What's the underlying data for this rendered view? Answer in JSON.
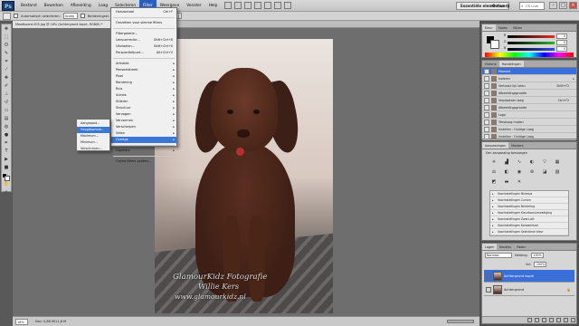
{
  "menubar": {
    "logo": "Ps",
    "items": [
      "Bestand",
      "Bewerken",
      "Afbeelding",
      "Laag",
      "Selecteren",
      "Filter",
      "Weergave",
      "Venster",
      "Help"
    ],
    "active_index": 5,
    "workspace_primary": "Essentiële elementen",
    "workspace_secondary": "Ontwerp",
    "search_label": "CS Live"
  },
  "options": {
    "auto_select_label": "Automatisch selecteren:",
    "auto_select_value": "Groep",
    "transform_label": "Bedieningsel. tonen"
  },
  "document": {
    "tab_title": "Moodboard-003.jpg @ 18% (Achtergrond kopie, RGB/8) *"
  },
  "photo": {
    "watermark_line1": "GlamourKidz Fotografie",
    "watermark_line2": "Willie Kers",
    "watermark_line3": "www.glamourkidz.nl"
  },
  "statusbar": {
    "zoom": "18%",
    "doc_info": "Doc: 5,88 M/11,8 M"
  },
  "filter_menu": {
    "items": [
      {
        "label": "Horizontaal",
        "shortcut": "Ctrl+F",
        "disabled": false
      },
      {
        "sep": true
      },
      {
        "label": "Omzetten voor slimme filters",
        "disabled": false
      },
      {
        "sep": true
      },
      {
        "label": "Filtergalerie...",
        "disabled": false
      },
      {
        "label": "Lenscorrectie...",
        "shortcut": "Shift+Ctrl+R",
        "disabled": false
      },
      {
        "label": "Uitvloeien...",
        "shortcut": "Shift+Ctrl+X",
        "disabled": false
      },
      {
        "label": "Perspectiefpunt...",
        "shortcut": "Alt+Ctrl+V",
        "disabled": false
      },
      {
        "sep": true
      },
      {
        "label": "Artistiek",
        "submenu": true
      },
      {
        "label": "Penseelstreek",
        "submenu": true
      },
      {
        "label": "Pixel",
        "submenu": true
      },
      {
        "label": "Rendering",
        "submenu": true
      },
      {
        "label": "Ruis",
        "submenu": true
      },
      {
        "label": "Schets",
        "submenu": true
      },
      {
        "label": "Stileren",
        "submenu": true
      },
      {
        "label": "Structuur",
        "submenu": true
      },
      {
        "label": "Vervagen",
        "submenu": true
      },
      {
        "label": "Vervormen",
        "submenu": true
      },
      {
        "label": "Verscherpen",
        "submenu": true
      },
      {
        "label": "Video",
        "submenu": true
      },
      {
        "label": "Overige",
        "submenu": true,
        "highlighted": true
      },
      {
        "sep": true
      },
      {
        "label": "Digimarc",
        "submenu": true
      },
      {
        "sep": true
      },
      {
        "label": "Online filters zoeken...",
        "disabled": false
      }
    ]
  },
  "submenu": {
    "items": [
      "Aangepast...",
      "Hoogdoorlaat...",
      "Maximum...",
      "Minimum...",
      "Verschuiven..."
    ],
    "highlighted_index": 1
  },
  "color_panel": {
    "tabs": [
      "Kleur",
      "Stalen",
      "Stijlen"
    ],
    "sliders": [
      {
        "label": "R",
        "value": "0",
        "color": "#e03030"
      },
      {
        "label": "G",
        "value": "0",
        "color": "#30b030"
      },
      {
        "label": "B",
        "value": "0",
        "color": "#3050e0"
      }
    ]
  },
  "history_panel": {
    "tabs": [
      "Historie",
      "Handelingen"
    ],
    "rows": [
      {
        "label": "Moment",
        "keys": "",
        "selected": true
      },
      {
        "label": "Isoleren",
        "keys": ""
      },
      {
        "label": "Verticale lijn laten",
        "keys": "Shift+F2"
      },
      {
        "label": "Afbeeldingsgrootte",
        "keys": ""
      },
      {
        "label": "Verplaatsen laag",
        "keys": "Ctrl+F2"
      },
      {
        "label": "Afbeeldingsgrootte",
        "keys": ""
      },
      {
        "label": "Logo",
        "keys": ""
      },
      {
        "label": "Tekstlaag maken",
        "keys": ""
      },
      {
        "label": "Instellen : Huidige Laag",
        "keys": ""
      },
      {
        "label": "Instellen : Huidige Laag",
        "keys": ""
      }
    ]
  },
  "adjustments_panel": {
    "tabs": [
      "Aanpassingen",
      "Maskers"
    ],
    "title": "Een aanpassing toevoegen",
    "icons": [
      "brightness-icon",
      "levels-icon",
      "curves-icon",
      "exposure-icon",
      "vibrance-icon",
      "hue-icon",
      "balance-icon",
      "bw-icon",
      "photo-filter-icon",
      "channel-mixer-icon",
      "invert-icon",
      "posterize-icon",
      "threshold-icon",
      "gradient-map-icon",
      "selective-color-icon"
    ],
    "presets": [
      "Voorinstellingen Niveaus",
      "Voorinstellingen Curven",
      "Voorinstellingen Belichting",
      "Voorinstellingen Kleurtoon/verzadiging",
      "Voorinstellingen Zwart-wit",
      "Voorinstellingen Kanaalmixer",
      "Voorinstellingen Selectieve kleur"
    ]
  },
  "layers_panel": {
    "tabs": [
      "Lagen",
      "Kanalen",
      "Paden"
    ],
    "blend_mode": "Normaal",
    "opacity_label": "Dekking:",
    "opacity": "100%",
    "fill_label": "Vul:",
    "fill": "100%",
    "layers": [
      {
        "label": "Achtergrond kopie",
        "selected": true
      },
      {
        "label": "Achtergrond",
        "selected": false,
        "locked": true
      }
    ]
  },
  "colors": {
    "accent": "#3978d6",
    "menu_active": "#2b5fbf",
    "canvas_bg": "#6e6e6e"
  }
}
